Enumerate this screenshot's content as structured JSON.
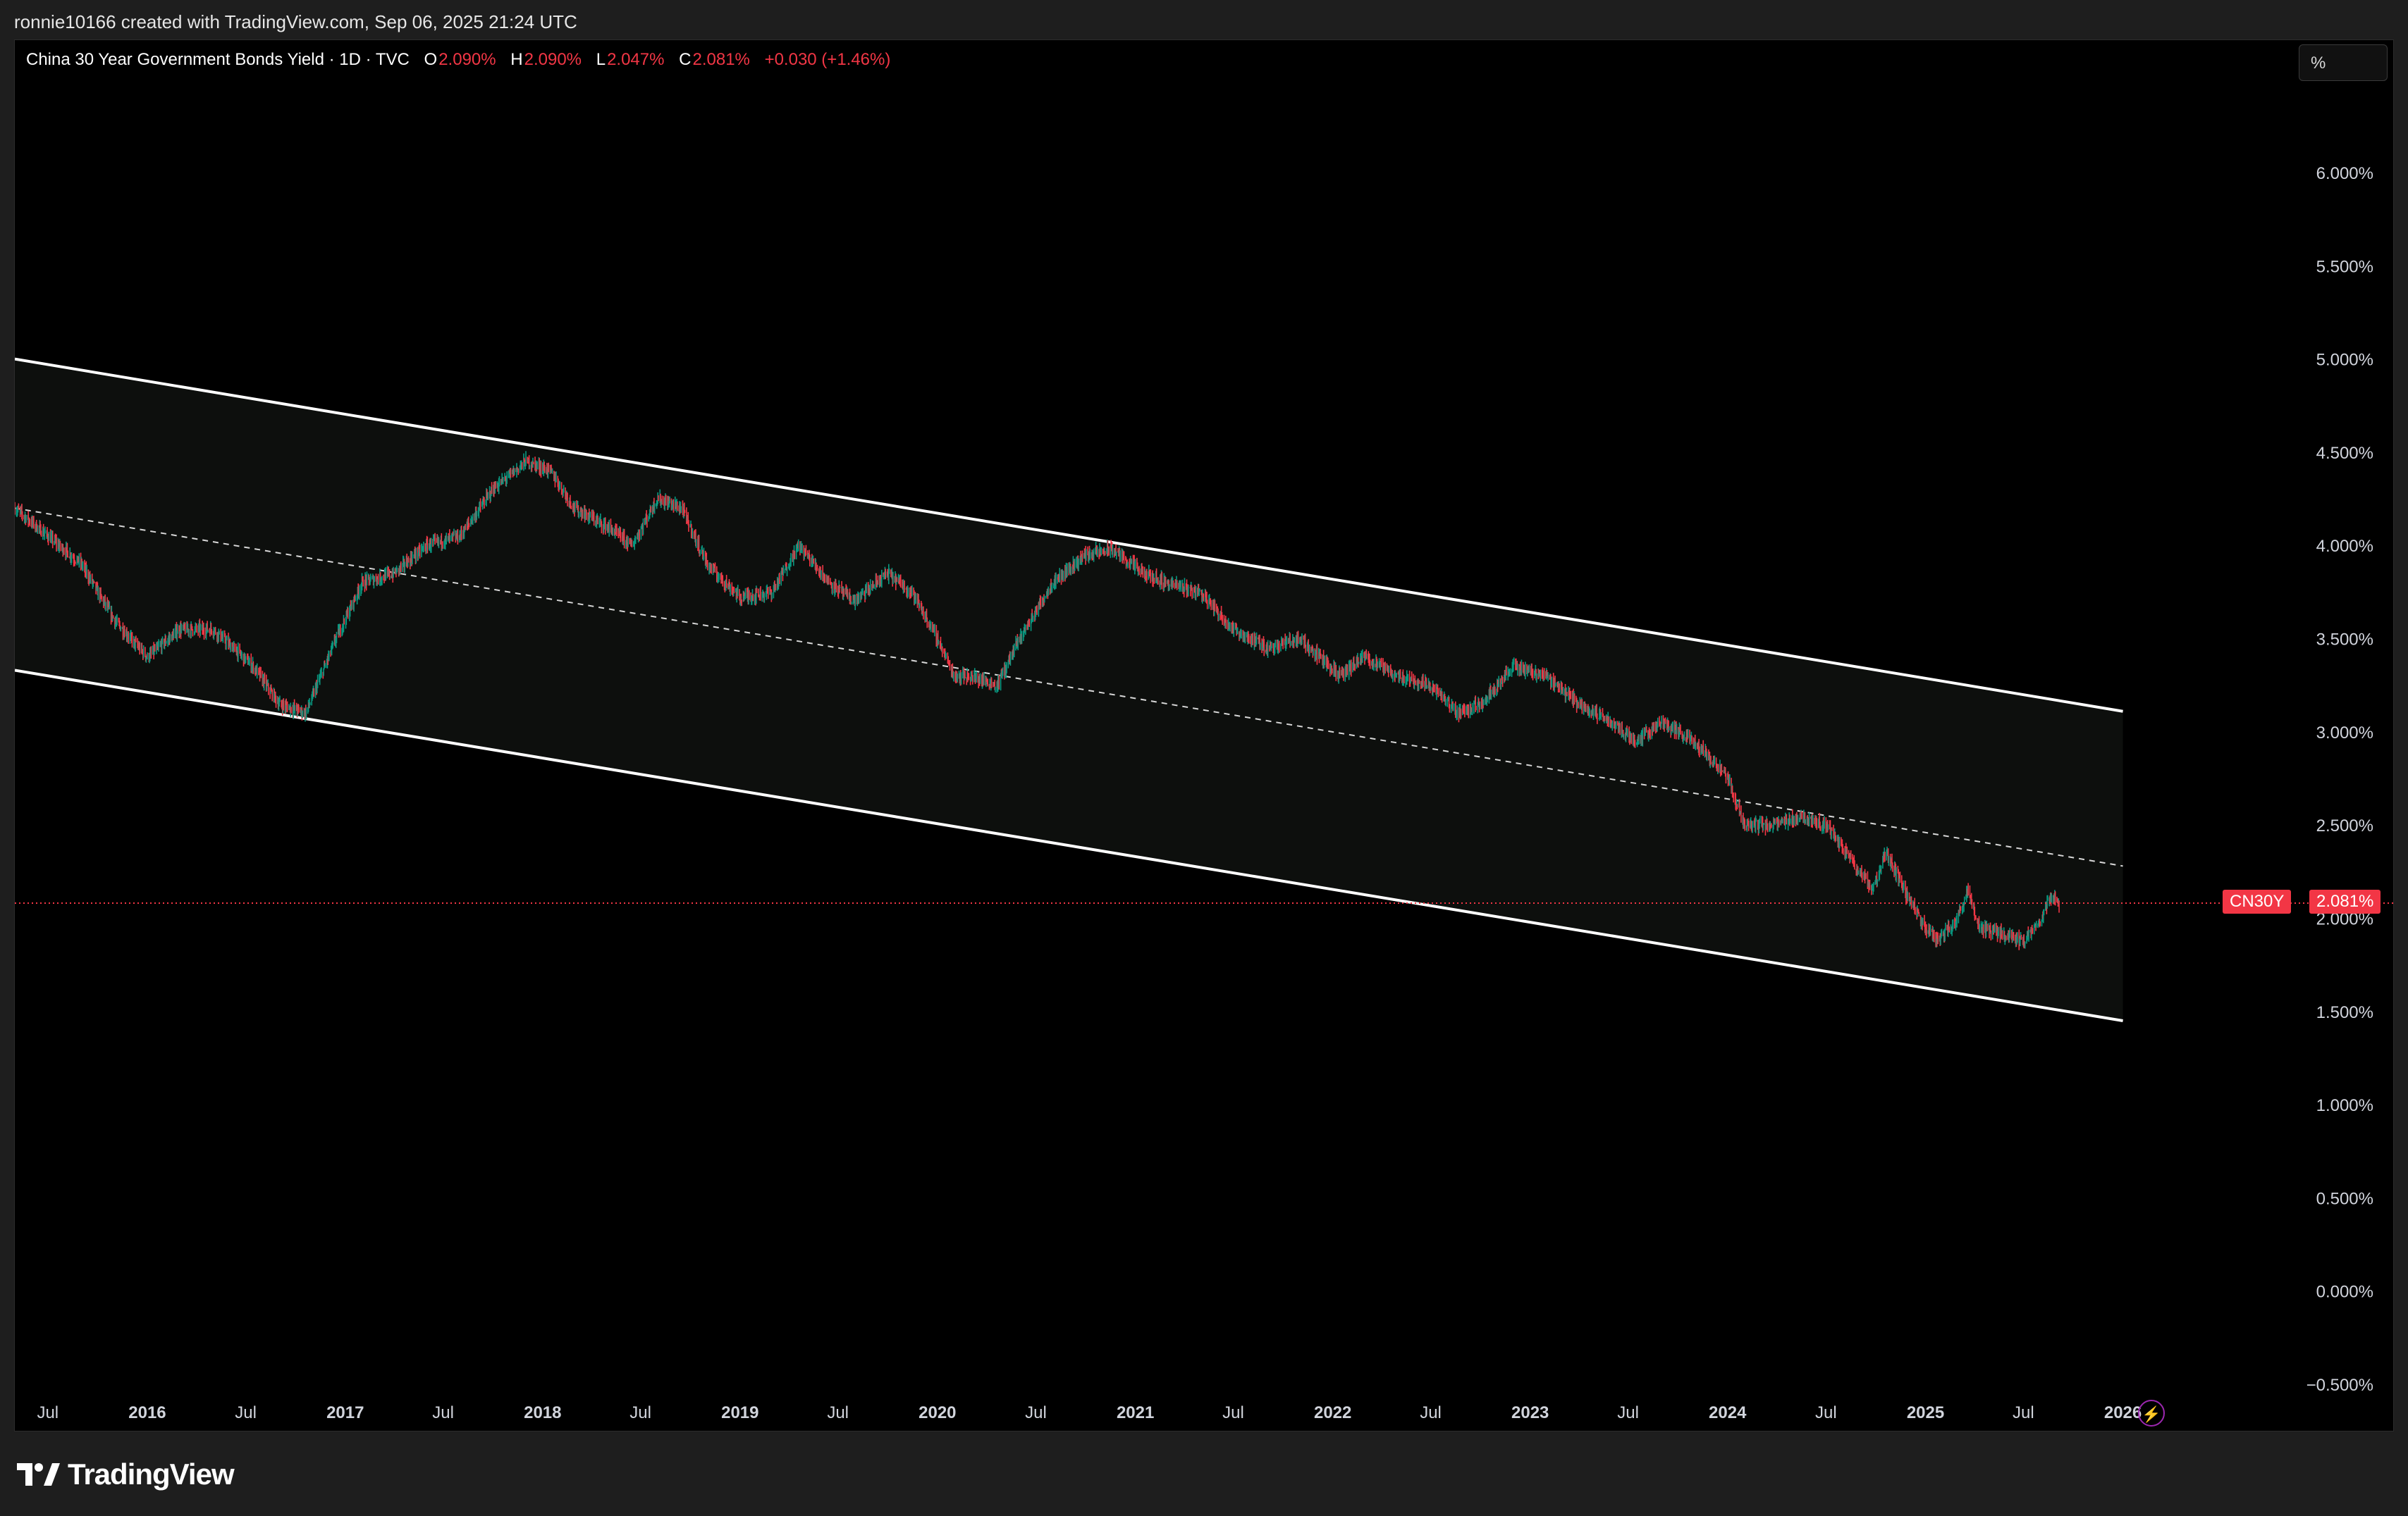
{
  "header": {
    "attribution": "ronnie10166 created with TradingView.com, Sep 06, 2025 21:24 UTC"
  },
  "legend": {
    "title": "China 30 Year Government Bonds Yield · 1D · TVC",
    "open_label": "O",
    "open": "2.090%",
    "high_label": "H",
    "high": "2.090%",
    "low_label": "L",
    "low": "2.047%",
    "close_label": "C",
    "close": "2.081%",
    "change": "+0.030 (+1.46%)"
  },
  "toolbar": {
    "unit_button": "%"
  },
  "price_badge": {
    "symbol": "CN30Y",
    "value": "2.081%"
  },
  "footer": {
    "brand": "TradingView"
  },
  "colors": {
    "background": "#000000",
    "up": "#089981",
    "down": "#f23645",
    "channel_line": "#ffffff",
    "channel_fill": "#0d0f0d",
    "last_price_line": "#f23645",
    "axis_text": "#d1d4dc"
  },
  "icons": {
    "logo": "tradingview-logo-icon",
    "alert": "lightning-bolt-icon"
  },
  "chart_data": {
    "type": "candlestick",
    "title": "China 30 Year Government Bonds Yield · 1D · TVC",
    "symbol": "CN30Y",
    "interval": "1D",
    "last_value": 2.081,
    "y_unit": "%",
    "ylim": [
      -0.5,
      6.0
    ],
    "y_ticks": [
      {
        "value": 6.0,
        "label": "6.000%"
      },
      {
        "value": 5.5,
        "label": "5.500%"
      },
      {
        "value": 5.0,
        "label": "5.000%"
      },
      {
        "value": 4.5,
        "label": "4.500%"
      },
      {
        "value": 4.0,
        "label": "4.000%"
      },
      {
        "value": 3.5,
        "label": "3.500%"
      },
      {
        "value": 3.0,
        "label": "3.000%"
      },
      {
        "value": 2.5,
        "label": "2.500%"
      },
      {
        "value": 2.0,
        "label": "2.000%"
      },
      {
        "value": 1.5,
        "label": "1.500%"
      },
      {
        "value": 1.0,
        "label": "1.000%"
      },
      {
        "value": 0.5,
        "label": "0.500%"
      },
      {
        "value": 0.0,
        "label": "0.000%"
      },
      {
        "value": -0.5,
        "label": "−0.500%"
      }
    ],
    "x_ticks": [
      {
        "date": "2015-07-01",
        "label": "Jul",
        "bold": false
      },
      {
        "date": "2016-01-01",
        "label": "2016",
        "bold": true
      },
      {
        "date": "2016-07-01",
        "label": "Jul",
        "bold": false
      },
      {
        "date": "2017-01-01",
        "label": "2017",
        "bold": true
      },
      {
        "date": "2017-07-01",
        "label": "Jul",
        "bold": false
      },
      {
        "date": "2018-01-01",
        "label": "2018",
        "bold": true
      },
      {
        "date": "2018-07-01",
        "label": "Jul",
        "bold": false
      },
      {
        "date": "2019-01-01",
        "label": "2019",
        "bold": true
      },
      {
        "date": "2019-07-01",
        "label": "Jul",
        "bold": false
      },
      {
        "date": "2020-01-01",
        "label": "2020",
        "bold": true
      },
      {
        "date": "2020-07-01",
        "label": "Jul",
        "bold": false
      },
      {
        "date": "2021-01-01",
        "label": "2021",
        "bold": true
      },
      {
        "date": "2021-07-01",
        "label": "Jul",
        "bold": false
      },
      {
        "date": "2022-01-01",
        "label": "2022",
        "bold": true
      },
      {
        "date": "2022-07-01",
        "label": "Jul",
        "bold": false
      },
      {
        "date": "2023-01-01",
        "label": "2023",
        "bold": true
      },
      {
        "date": "2023-07-01",
        "label": "Jul",
        "bold": false
      },
      {
        "date": "2024-01-01",
        "label": "2024",
        "bold": true
      },
      {
        "date": "2024-07-01",
        "label": "Jul",
        "bold": false
      },
      {
        "date": "2025-01-01",
        "label": "2025",
        "bold": true
      },
      {
        "date": "2025-07-01",
        "label": "Jul",
        "bold": false
      },
      {
        "date": "2026-01-01",
        "label": "2026",
        "bold": true
      }
    ],
    "x_range": [
      "2015-05-01",
      "2026-10-01"
    ],
    "series_points": [
      {
        "date": "2015-05-01",
        "value": 4.2
      },
      {
        "date": "2015-07-01",
        "value": 4.05
      },
      {
        "date": "2015-09-01",
        "value": 3.9
      },
      {
        "date": "2015-11-01",
        "value": 3.6
      },
      {
        "date": "2016-01-01",
        "value": 3.4
      },
      {
        "date": "2016-03-01",
        "value": 3.55
      },
      {
        "date": "2016-05-01",
        "value": 3.55
      },
      {
        "date": "2016-07-15",
        "value": 3.35
      },
      {
        "date": "2016-09-01",
        "value": 3.15
      },
      {
        "date": "2016-10-20",
        "value": 3.1
      },
      {
        "date": "2016-12-15",
        "value": 3.5
      },
      {
        "date": "2017-02-01",
        "value": 3.8
      },
      {
        "date": "2017-04-01",
        "value": 3.85
      },
      {
        "date": "2017-06-01",
        "value": 4.0
      },
      {
        "date": "2017-08-01",
        "value": 4.05
      },
      {
        "date": "2017-10-01",
        "value": 4.3
      },
      {
        "date": "2017-12-01",
        "value": 4.45
      },
      {
        "date": "2018-01-15",
        "value": 4.4
      },
      {
        "date": "2018-03-01",
        "value": 4.2
      },
      {
        "date": "2018-05-01",
        "value": 4.1
      },
      {
        "date": "2018-06-15",
        "value": 4.0
      },
      {
        "date": "2018-08-01",
        "value": 4.25
      },
      {
        "date": "2018-09-15",
        "value": 4.2
      },
      {
        "date": "2018-11-01",
        "value": 3.9
      },
      {
        "date": "2019-01-01",
        "value": 3.72
      },
      {
        "date": "2019-03-01",
        "value": 3.75
      },
      {
        "date": "2019-04-20",
        "value": 4.0
      },
      {
        "date": "2019-06-15",
        "value": 3.8
      },
      {
        "date": "2019-08-01",
        "value": 3.7
      },
      {
        "date": "2019-10-01",
        "value": 3.85
      },
      {
        "date": "2019-11-15",
        "value": 3.75
      },
      {
        "date": "2020-01-01",
        "value": 3.5
      },
      {
        "date": "2020-02-01",
        "value": 3.3
      },
      {
        "date": "2020-03-01",
        "value": 3.3
      },
      {
        "date": "2020-04-20",
        "value": 3.25
      },
      {
        "date": "2020-06-01",
        "value": 3.5
      },
      {
        "date": "2020-08-01",
        "value": 3.8
      },
      {
        "date": "2020-10-01",
        "value": 3.95
      },
      {
        "date": "2020-11-20",
        "value": 3.98
      },
      {
        "date": "2021-01-15",
        "value": 3.85
      },
      {
        "date": "2021-03-01",
        "value": 3.8
      },
      {
        "date": "2021-05-01",
        "value": 3.75
      },
      {
        "date": "2021-07-01",
        "value": 3.55
      },
      {
        "date": "2021-09-01",
        "value": 3.45
      },
      {
        "date": "2021-11-01",
        "value": 3.5
      },
      {
        "date": "2022-01-15",
        "value": 3.3
      },
      {
        "date": "2022-03-01",
        "value": 3.4
      },
      {
        "date": "2022-05-01",
        "value": 3.3
      },
      {
        "date": "2022-07-01",
        "value": 3.25
      },
      {
        "date": "2022-08-20",
        "value": 3.1
      },
      {
        "date": "2022-10-01",
        "value": 3.15
      },
      {
        "date": "2022-12-01",
        "value": 3.35
      },
      {
        "date": "2023-02-01",
        "value": 3.3
      },
      {
        "date": "2023-04-01",
        "value": 3.15
      },
      {
        "date": "2023-06-01",
        "value": 3.05
      },
      {
        "date": "2023-07-15",
        "value": 2.95
      },
      {
        "date": "2023-09-01",
        "value": 3.05
      },
      {
        "date": "2023-11-01",
        "value": 2.95
      },
      {
        "date": "2024-01-01",
        "value": 2.75
      },
      {
        "date": "2024-02-01",
        "value": 2.5
      },
      {
        "date": "2024-04-01",
        "value": 2.5
      },
      {
        "date": "2024-05-15",
        "value": 2.55
      },
      {
        "date": "2024-07-01",
        "value": 2.5
      },
      {
        "date": "2024-08-20",
        "value": 2.3
      },
      {
        "date": "2024-09-25",
        "value": 2.15
      },
      {
        "date": "2024-10-20",
        "value": 2.35
      },
      {
        "date": "2024-12-01",
        "value": 2.1
      },
      {
        "date": "2025-01-01",
        "value": 1.95
      },
      {
        "date": "2025-01-25",
        "value": 1.88
      },
      {
        "date": "2025-03-01",
        "value": 2.0
      },
      {
        "date": "2025-03-20",
        "value": 2.15
      },
      {
        "date": "2025-04-10",
        "value": 1.95
      },
      {
        "date": "2025-05-15",
        "value": 1.92
      },
      {
        "date": "2025-07-01",
        "value": 1.88
      },
      {
        "date": "2025-08-01",
        "value": 1.98
      },
      {
        "date": "2025-08-20",
        "value": 2.12
      },
      {
        "date": "2025-09-05",
        "value": 2.081
      }
    ],
    "channel": {
      "upper": [
        {
          "date": "2015-05-01",
          "value": 5.0
        },
        {
          "date": "2026-01-01",
          "value": 3.11
        }
      ],
      "middle": [
        {
          "date": "2015-05-01",
          "value": 4.2
        },
        {
          "date": "2026-01-01",
          "value": 2.28
        }
      ],
      "lower": [
        {
          "date": "2015-05-01",
          "value": 3.33
        },
        {
          "date": "2026-01-01",
          "value": 1.45
        }
      ]
    }
  }
}
